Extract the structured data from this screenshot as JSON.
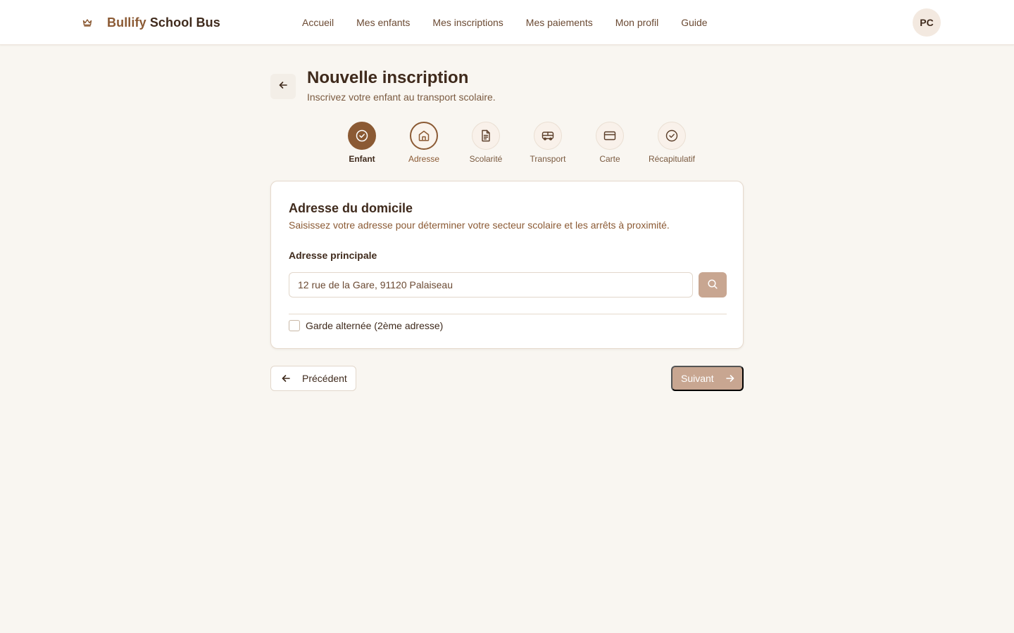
{
  "header": {
    "brand_first": "Bullify",
    "brand_second": "School Bus",
    "nav": [
      "Accueil",
      "Mes enfants",
      "Mes inscriptions",
      "Mes paiements",
      "Mon profil",
      "Guide"
    ],
    "avatar_initials": "PC"
  },
  "page": {
    "title": "Nouvelle inscription",
    "subtitle": "Inscrivez votre enfant au transport scolaire."
  },
  "steps": [
    {
      "label": "Enfant",
      "state": "done",
      "icon": "check-circle-icon"
    },
    {
      "label": "Adresse",
      "state": "active",
      "icon": "home-icon"
    },
    {
      "label": "Scolarité",
      "state": "pending",
      "icon": "document-icon"
    },
    {
      "label": "Transport",
      "state": "pending",
      "icon": "bus-icon"
    },
    {
      "label": "Carte",
      "state": "pending",
      "icon": "card-icon"
    },
    {
      "label": "Récapitulatif",
      "state": "pending",
      "icon": "check-circle-icon"
    }
  ],
  "card": {
    "title": "Adresse du domicile",
    "description": "Saisissez votre adresse pour déterminer votre secteur scolaire et les arrêts à proximité.",
    "field_label": "Adresse principale",
    "address_value": "12 rue de la Gare, 91120 Palaiseau",
    "checkbox_label": "Garde alternée (2ème adresse)",
    "checkbox_checked": false
  },
  "actions": {
    "previous": "Précédent",
    "next": "Suivant"
  },
  "colors": {
    "accent": "#8b5a34",
    "accent_muted": "#c8a691",
    "background": "#f9f6f1"
  }
}
